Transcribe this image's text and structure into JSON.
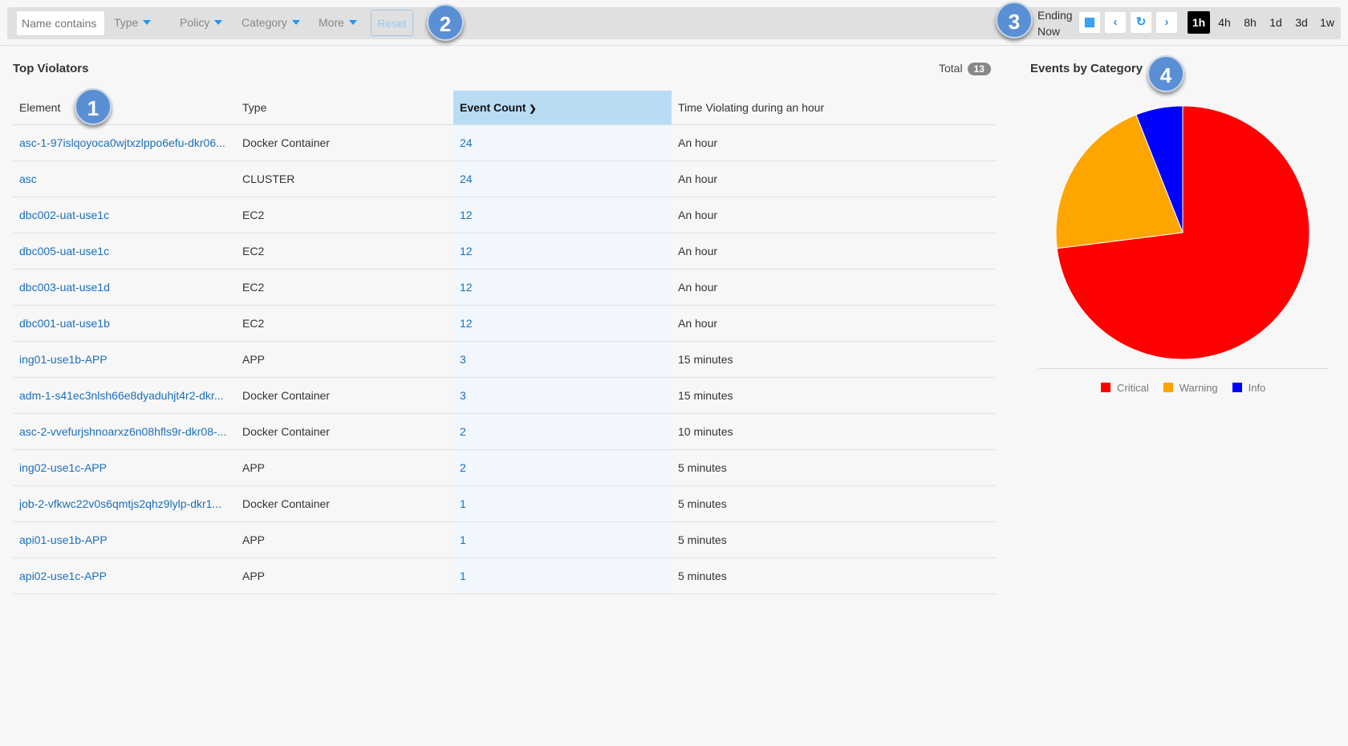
{
  "toolbar": {
    "search_placeholder": "Name contains",
    "filters": [
      "Type",
      "Policy",
      "Category",
      "More"
    ],
    "reset": "Reset",
    "ending_label": "Ending",
    "ending_value": "Now",
    "ranges": [
      "1h",
      "4h",
      "8h",
      "1d",
      "3d",
      "1w"
    ],
    "active_range": "1h"
  },
  "annotations": [
    "1",
    "2",
    "3",
    "4"
  ],
  "violators": {
    "title": "Top Violators",
    "total_label": "Total",
    "total": "13",
    "columns": [
      "Element",
      "Type",
      "Event Count",
      "Time Violating during an hour"
    ],
    "rows": [
      [
        "asc-1-97islqoyoca0wjtxzlppo6efu-dkr06...",
        "Docker Container",
        "24",
        "An hour"
      ],
      [
        "asc",
        "CLUSTER",
        "24",
        "An hour"
      ],
      [
        "dbc002-uat-use1c",
        "EC2",
        "12",
        "An hour"
      ],
      [
        "dbc005-uat-use1c",
        "EC2",
        "12",
        "An hour"
      ],
      [
        "dbc003-uat-use1d",
        "EC2",
        "12",
        "An hour"
      ],
      [
        "dbc001-uat-use1b",
        "EC2",
        "12",
        "An hour"
      ],
      [
        "ing01-use1b-APP",
        "APP",
        "3",
        "15 minutes"
      ],
      [
        "adm-1-s41ec3nlsh66e8dyaduhjt4r2-dkr...",
        "Docker Container",
        "3",
        "15 minutes"
      ],
      [
        "asc-2-vvefurjshnoarxz6n08hfls9r-dkr08-...",
        "Docker Container",
        "2",
        "10 minutes"
      ],
      [
        "ing02-use1c-APP",
        "APP",
        "2",
        "5 minutes"
      ],
      [
        "job-2-vfkwc22v0s6qmtjs2qhz9lylp-dkr1...",
        "Docker Container",
        "1",
        "5 minutes"
      ],
      [
        "api01-use1b-APP",
        "APP",
        "1",
        "5 minutes"
      ],
      [
        "api02-use1c-APP",
        "APP",
        "1",
        "5 minutes"
      ]
    ]
  },
  "chart_data": {
    "type": "pie",
    "title": "Events by Category",
    "legend_position": "bottom",
    "categories": [
      "Critical",
      "Warning",
      "Info"
    ],
    "values": [
      73,
      21,
      6
    ],
    "colors": [
      "#ff0000",
      "#ffa500",
      "#0000ff"
    ]
  }
}
